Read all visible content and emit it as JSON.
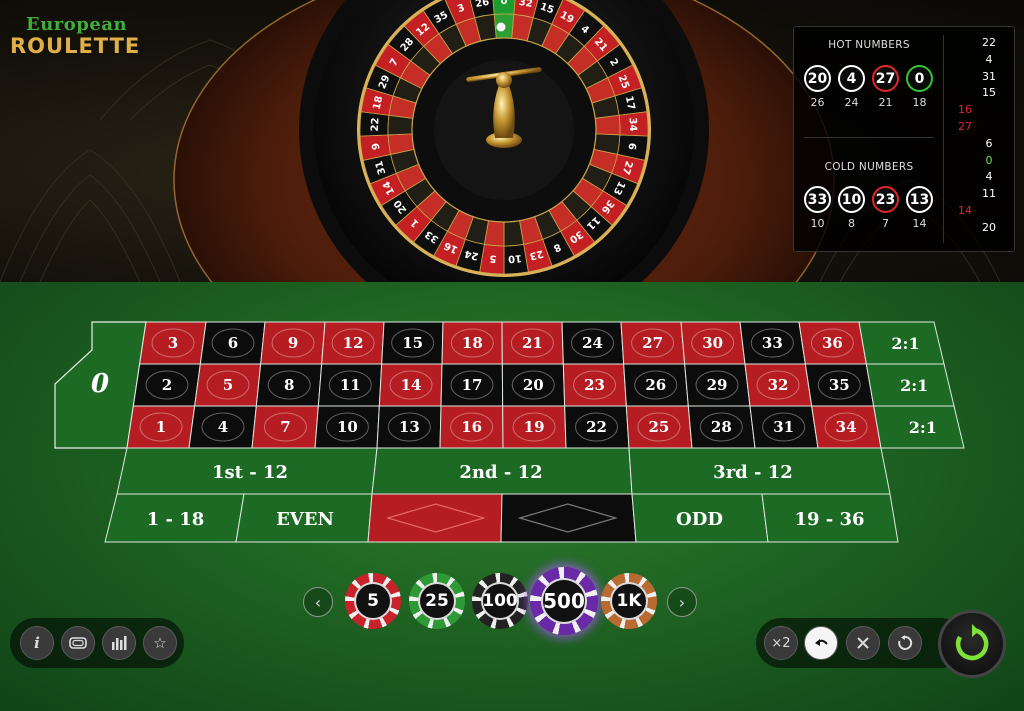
{
  "logo": {
    "line1": "European",
    "line2": "ROULETTE"
  },
  "wheel": {
    "sequence": [
      "0",
      "32",
      "15",
      "19",
      "4",
      "21",
      "2",
      "25",
      "17",
      "34",
      "6",
      "27",
      "13",
      "36",
      "11",
      "30",
      "8",
      "23",
      "10",
      "5",
      "24",
      "16",
      "33",
      "1",
      "20",
      "14",
      "31",
      "9",
      "22",
      "18",
      "29",
      "7",
      "28",
      "12",
      "35",
      "3",
      "26"
    ]
  },
  "stats": {
    "hot_title": "HOT NUMBERS",
    "cold_title": "COLD NUMBERS",
    "hot": [
      {
        "num": "20",
        "count": "26",
        "color": "black"
      },
      {
        "num": "4",
        "count": "24",
        "color": "black"
      },
      {
        "num": "27",
        "count": "21",
        "color": "red"
      },
      {
        "num": "0",
        "count": "18",
        "color": "green"
      }
    ],
    "cold": [
      {
        "num": "33",
        "count": "10",
        "color": "black"
      },
      {
        "num": "10",
        "count": "8",
        "color": "black"
      },
      {
        "num": "23",
        "count": "7",
        "color": "red"
      },
      {
        "num": "13",
        "count": "14",
        "color": "black"
      }
    ],
    "history": [
      {
        "num": "22",
        "color": "black",
        "side": "right"
      },
      {
        "num": "4",
        "color": "black",
        "side": "right"
      },
      {
        "num": "31",
        "color": "black",
        "side": "right"
      },
      {
        "num": "15",
        "color": "black",
        "side": "right"
      },
      {
        "num": "16",
        "color": "red",
        "side": "left"
      },
      {
        "num": "27",
        "color": "red",
        "side": "left"
      },
      {
        "num": "6",
        "color": "black",
        "side": "right"
      },
      {
        "num": "0",
        "color": "green",
        "side": "right"
      },
      {
        "num": "4",
        "color": "black",
        "side": "right"
      },
      {
        "num": "11",
        "color": "black",
        "side": "right"
      },
      {
        "num": "14",
        "color": "red",
        "side": "left"
      },
      {
        "num": "20",
        "color": "black",
        "side": "right"
      }
    ]
  },
  "table": {
    "zero": "0",
    "rows": [
      [
        "3",
        "6",
        "9",
        "12",
        "15",
        "18",
        "21",
        "24",
        "27",
        "30",
        "33",
        "36"
      ],
      [
        "2",
        "5",
        "8",
        "11",
        "14",
        "17",
        "20",
        "23",
        "26",
        "29",
        "32",
        "35"
      ],
      [
        "1",
        "4",
        "7",
        "10",
        "13",
        "16",
        "19",
        "22",
        "25",
        "28",
        "31",
        "34"
      ]
    ],
    "red_numbers": [
      "1",
      "3",
      "5",
      "7",
      "9",
      "12",
      "14",
      "16",
      "18",
      "19",
      "21",
      "23",
      "25",
      "27",
      "30",
      "32",
      "34",
      "36"
    ],
    "columns": [
      "2:1",
      "2:1",
      "2:1"
    ],
    "dozens": [
      "1st - 12",
      "2nd - 12",
      "3rd - 12"
    ],
    "outside": {
      "low": "1 - 18",
      "even": "EVEN",
      "odd": "ODD",
      "high": "19 - 36"
    }
  },
  "chips": [
    {
      "label": "5",
      "color": "#c8222a"
    },
    {
      "label": "25",
      "color": "#2e9a36"
    },
    {
      "label": "100",
      "color": "#222222"
    },
    {
      "label": "500",
      "color": "#6a2aa8"
    },
    {
      "label": "1K",
      "color": "#b86a30"
    }
  ],
  "chip_selected": "500",
  "toolbar": {
    "info": "i",
    "double": "×2",
    "icons": [
      "info-icon",
      "layout-icon",
      "stats-icon",
      "favorite-star-icon"
    ],
    "action_icons": [
      "double-bet-icon",
      "undo-icon",
      "clear-bets-icon",
      "rebet-icon",
      "spin-icon"
    ]
  }
}
